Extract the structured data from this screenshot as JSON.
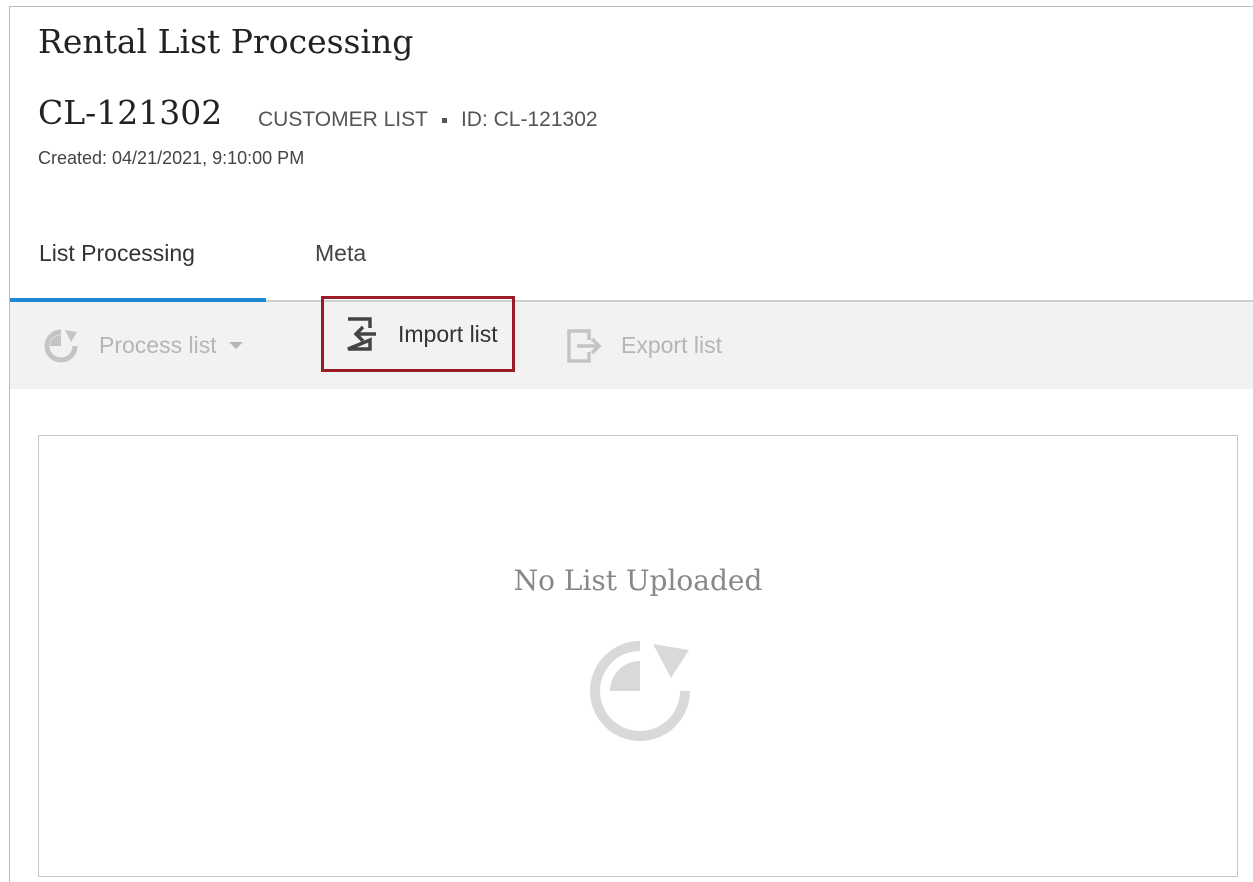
{
  "header": {
    "title": "Rental List Processing",
    "record_id": "CL-121302",
    "record_type": "CUSTOMER LIST",
    "record_ref": "ID: CL-121302",
    "created": "Created: 04/21/2021, 9:10:00 PM"
  },
  "tabs": [
    {
      "label": "List Processing",
      "active": true
    },
    {
      "label": "Meta",
      "active": false
    }
  ],
  "toolbar": {
    "process_label": "Process list",
    "import_label": "Import list",
    "export_label": "Export list"
  },
  "panel": {
    "empty_message": "No List Uploaded"
  },
  "icons": {
    "process": "process-cycle-icon",
    "import": "import-icon",
    "export": "export-icon",
    "empty": "process-cycle-icon"
  },
  "colors": {
    "accent": "#1e88d6",
    "highlight_border": "#9b1c26",
    "toolbar_bg": "#f2f2f2",
    "disabled_text": "#b5b5b5"
  }
}
